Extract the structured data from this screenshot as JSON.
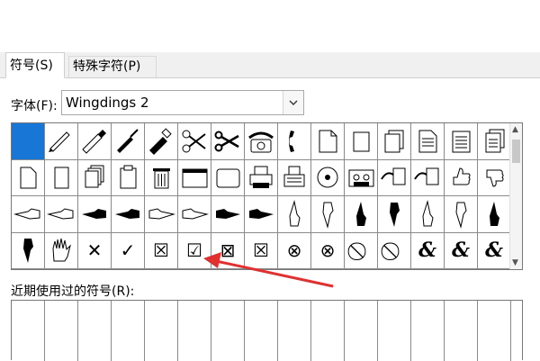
{
  "tabs": [
    {
      "label": "符号(S)",
      "active": true
    },
    {
      "label": "特殊字符(P)",
      "active": false
    }
  ],
  "font": {
    "label": "字体(F):",
    "value": "Wingdings 2"
  },
  "symbol_grid": {
    "selected_index": 0,
    "rows": [
      [
        "selected-blank",
        "pen-icon",
        "fountain-pen-icon",
        "brush-icon",
        "marker-icon",
        "scissors-open-icon",
        "scissors-icon",
        "telephone-icon",
        "phone-handset-icon",
        "document-icon",
        "blank-page-icon",
        "stacked-pages-icon",
        "text-document-icon",
        "notepad-icon",
        "stacked-documents-icon"
      ],
      [
        "page-icon",
        "blank-document-icon",
        "multi-pages-icon",
        "clipboard-icon",
        "trash-can-icon",
        "window-icon",
        "screen-icon",
        "printer-icon",
        "fax-icon",
        "disc-icon",
        "cassette-icon",
        "hand-pointing-page-icon",
        "hand-pointing-page-icon",
        "hand-thumbs-up-icon",
        "hand-thumbs-down-icon"
      ],
      [
        "hand-point-left-icon",
        "hand-point-left-icon",
        "hand-point-left-black-icon",
        "hand-point-left-black-icon",
        "hand-point-right-icon",
        "hand-point-right-icon",
        "hand-point-right-black-icon",
        "hand-point-right-black-icon",
        "hand-point-up-icon",
        "hand-point-down-icon",
        "hand-point-up-black-icon",
        "hand-point-down-black-icon",
        "hand-point-up-icon",
        "hand-point-down-icon",
        "hand-point-up-black-icon"
      ],
      [
        "hand-point-down-black-icon",
        "open-hand-icon",
        "x-mark-icon",
        "check-mark-icon",
        "boxed-x-icon",
        "boxed-check-icon",
        "boxed-x-light-icon",
        "boxed-x-bold-icon",
        "circled-x-icon",
        "circled-x-bold-icon",
        "prohibited-icon",
        "prohibited-bold-icon",
        "et-ligature-icon",
        "ampersand-icon",
        "ampersand-italic-icon"
      ]
    ],
    "text_glyphs": {
      "x-mark-icon": "✕",
      "check-mark-icon": "✓",
      "boxed-x-icon": "☒",
      "boxed-check-icon": "☑",
      "boxed-x-light-icon": "⊠",
      "boxed-x-bold-icon": "☒",
      "circled-x-icon": "⊗",
      "circled-x-bold-icon": "⊗",
      "prohibited-icon": "⃠",
      "prohibited-bold-icon": "⃠",
      "et-ligature-icon": "&",
      "ampersand-icon": "&",
      "ampersand-italic-icon": "&"
    }
  },
  "recent": {
    "label": "近期使用过的符号(R):"
  },
  "colors": {
    "selection": "#1776d6",
    "annotation_arrow": "#e03030"
  }
}
